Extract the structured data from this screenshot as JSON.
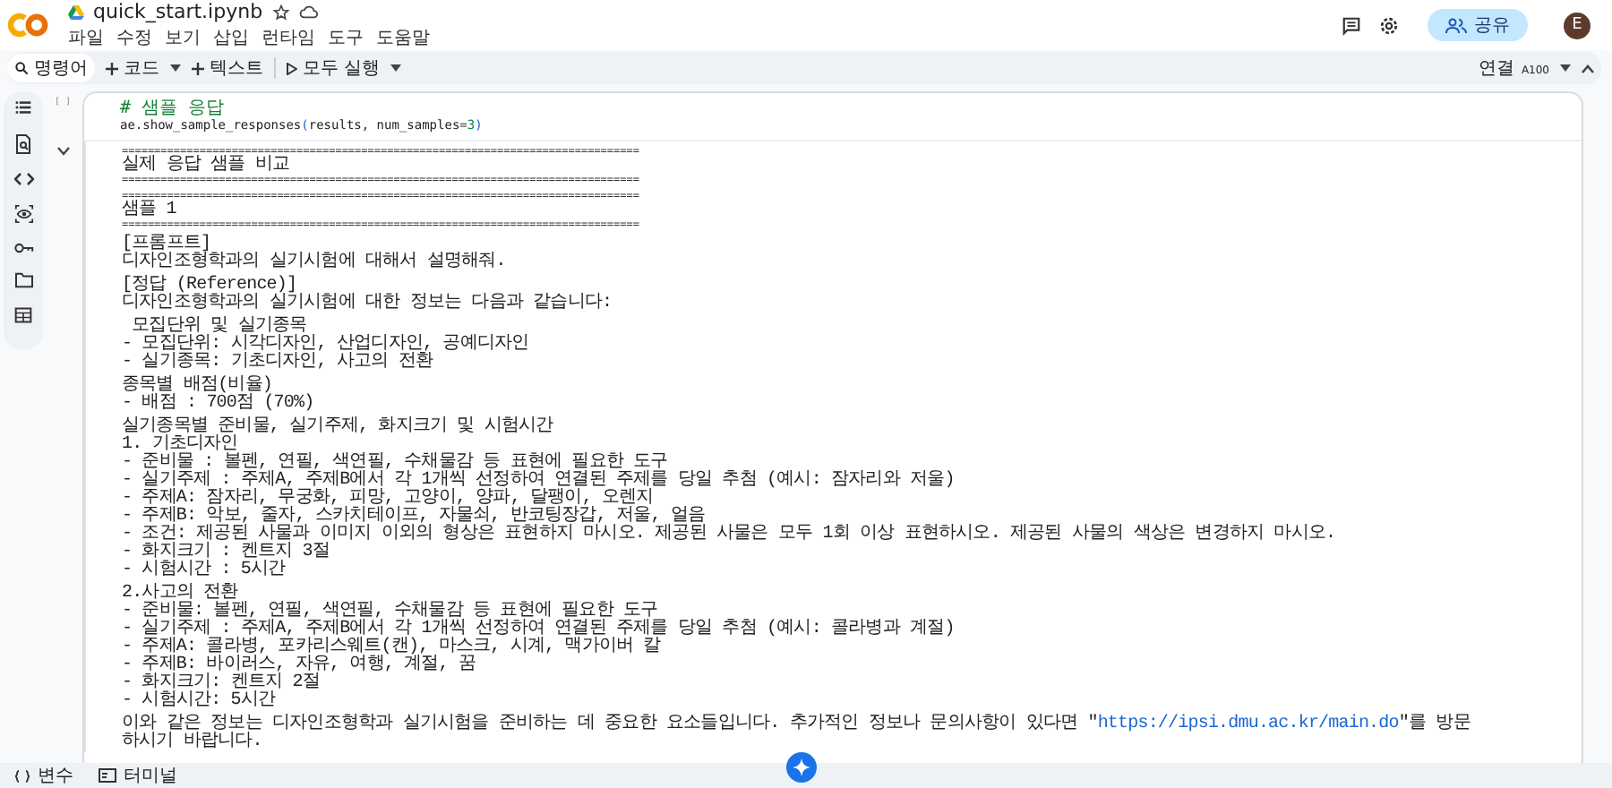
{
  "header": {
    "title": "quick_start.ipynb",
    "menu": [
      "파일",
      "수정",
      "보기",
      "삽입",
      "런타임",
      "도구",
      "도움말"
    ],
    "share_label": "공유",
    "avatar_letter": "E"
  },
  "toolbar": {
    "command_label": "명령어",
    "code_label": "코드",
    "text_label": "텍스트",
    "run_all_label": "모두 실행",
    "connect_label": "연결",
    "runtime": "A100"
  },
  "cell": {
    "gutter": "[ ]",
    "comment": "# 샘플 응답",
    "code": [
      {
        "kind": "plain",
        "text": "ae.show_sample_responses"
      },
      {
        "kind": "bracket",
        "text": "("
      },
      {
        "kind": "plain",
        "text": "results, num_samples="
      },
      {
        "kind": "number",
        "text": "3"
      },
      {
        "kind": "bracket",
        "text": ")"
      }
    ],
    "output": [
      {
        "kind": "rule",
        "text": "================================================================================"
      },
      {
        "kind": "text",
        "text": "실제 응답 샘플 비교"
      },
      {
        "kind": "rule",
        "text": "================================================================================"
      },
      {
        "kind": "blank"
      },
      {
        "kind": "rule",
        "text": "================================================================================"
      },
      {
        "kind": "text",
        "text": "샘플 1"
      },
      {
        "kind": "rule",
        "text": "================================================================================"
      },
      {
        "kind": "blank"
      },
      {
        "kind": "text",
        "text": "[프롬프트]"
      },
      {
        "kind": "text",
        "text": "디자인조형학과의 실기시험에 대해서 설명해줘."
      },
      {
        "kind": "blank"
      },
      {
        "kind": "text",
        "text": "[정답 (Reference)]"
      },
      {
        "kind": "text",
        "text": "디자인조형학과의 실기시험에 대한 정보는 다음과 같습니다:"
      },
      {
        "kind": "blank"
      },
      {
        "kind": "text",
        "text": " 모집단위 및 실기종목"
      },
      {
        "kind": "text",
        "text": "- 모집단위: 시각디자인, 산업디자인, 공예디자인"
      },
      {
        "kind": "text",
        "text": "- 실기종목: 기초디자인, 사고의 전환"
      },
      {
        "kind": "blank"
      },
      {
        "kind": "text",
        "text": "종목별 배점(비율)"
      },
      {
        "kind": "text",
        "text": "- 배점 : 700점 (70%)"
      },
      {
        "kind": "blank"
      },
      {
        "kind": "text",
        "text": "실기종목별 준비물, 실기주제, 화지크기 및 시험시간"
      },
      {
        "kind": "text",
        "text": "1. 기초디자인"
      },
      {
        "kind": "text",
        "text": "- 준비물 : 볼펜, 연필, 색연필, 수채물감 등 표현에 필요한 도구"
      },
      {
        "kind": "text",
        "text": "- 실기주제 : 주제A, 주제B에서 각 1개씩 선정하여 연결된 주제를 당일 추첨 (예시: 잠자리와 저울)"
      },
      {
        "kind": "text",
        "text": "- 주제A: 잠자리, 무궁화, 피망, 고양이, 양파, 달팽이, 오렌지"
      },
      {
        "kind": "text",
        "text": "- 주제B: 악보, 줄자, 스카치테이프, 자물쇠, 반코팅장갑, 저울, 얼음"
      },
      {
        "kind": "text",
        "text": "- 조건: 제공된 사물과 이미지 이외의 형상은 표현하지 마시오. 제공된 사물은 모두 1회 이상 표현하시오. 제공된 사물의 색상은 변경하지 마시오."
      },
      {
        "kind": "text",
        "text": "- 화지크기 : 켄트지 3절"
      },
      {
        "kind": "text",
        "text": "- 시험시간 : 5시간"
      },
      {
        "kind": "blank"
      },
      {
        "kind": "text",
        "text": "2.사고의 전환"
      },
      {
        "kind": "text",
        "text": "- 준비물: 볼펜, 연필, 색연필, 수채물감 등 표현에 필요한 도구"
      },
      {
        "kind": "text",
        "text": "- 실기주제 : 주제A, 주제B에서 각 1개씩 선정하여 연결된 주제를 당일 추첨 (예시: 콜라병과 계절)"
      },
      {
        "kind": "text",
        "text": "- 주제A: 콜라병, 포카리스웨트(캔), 마스크, 시계, 맥가이버 칼"
      },
      {
        "kind": "text",
        "text": "- 주제B: 바이러스, 자유, 여행, 계절, 꿈"
      },
      {
        "kind": "text",
        "text": "- 화지크기: 켄트지 2절"
      },
      {
        "kind": "text",
        "text": "- 시험시간: 5시간"
      },
      {
        "kind": "blank"
      },
      {
        "kind": "link_text",
        "before": "이와 같은 정보는 디자인조형학과 실기시험을 준비하는 데 중요한 요소들입니다. 추가적인 정보나 문의사항이 있다면 \"",
        "link": "https://ipsi.dmu.ac.kr/main.do",
        "after": "\"를 방문하시기 바랍니다."
      }
    ]
  },
  "bottom_bar": {
    "variables_label": "변수",
    "terminal_label": "터미널"
  }
}
